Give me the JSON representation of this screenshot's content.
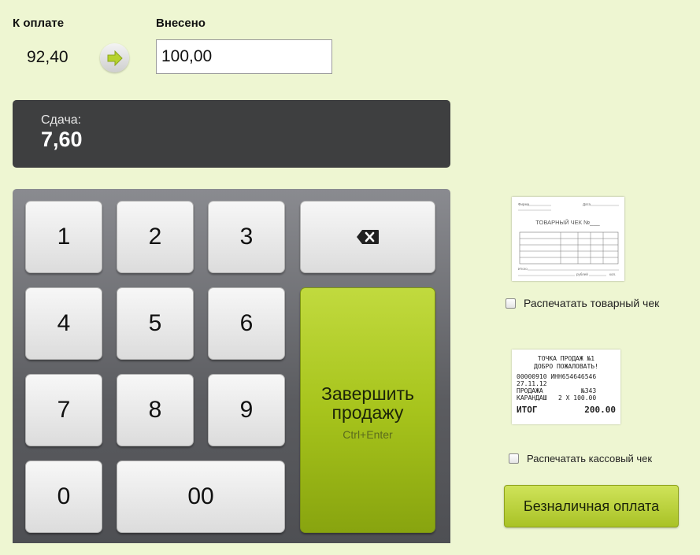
{
  "payment": {
    "due_label": "К оплате",
    "due_value": "92,40",
    "paid_label": "Внесено",
    "paid_value": "100,00"
  },
  "change": {
    "label": "Сдача:",
    "value": "7,60"
  },
  "keypad": {
    "keys": [
      "1",
      "2",
      "3",
      "4",
      "5",
      "6",
      "7",
      "8",
      "9",
      "0",
      "00"
    ],
    "backspace_icon": "backspace-icon",
    "finish_label": "Завершить продажу",
    "finish_hint": "Ctrl+Enter"
  },
  "receipts": {
    "invoice": {
      "title": "ТОВАРНЫЙ ЧЕК №___",
      "field_left": "Фирма",
      "field_date": "Дата",
      "field_bottom": "Итого",
      "field_rub": "рублей",
      "field_kop": "коп."
    },
    "invoice_checkbox_label": "Распечатать товарный чек",
    "invoice_checked": false,
    "cash": {
      "line1": "ТОЧКА ПРОДАЖ №1",
      "line2": "ДОБРО ПОЖАЛОВАТЬ!",
      "line3": "00000910 ИНН654646546",
      "line4": "27.11.12",
      "line5": "ПРОДАЖА          №343",
      "line6": "КАРАНДАШ   2 X 100.00",
      "total_label": "ИТОГ",
      "total_value": "200.00"
    },
    "cash_checkbox_label": "Распечатать кассовый чек",
    "cash_checked": false
  },
  "cashless_button": "Безналичная оплата",
  "colors": {
    "background": "#eef6d2",
    "change_panel": "#3e3f40",
    "accent_green": "#a7c41c"
  }
}
